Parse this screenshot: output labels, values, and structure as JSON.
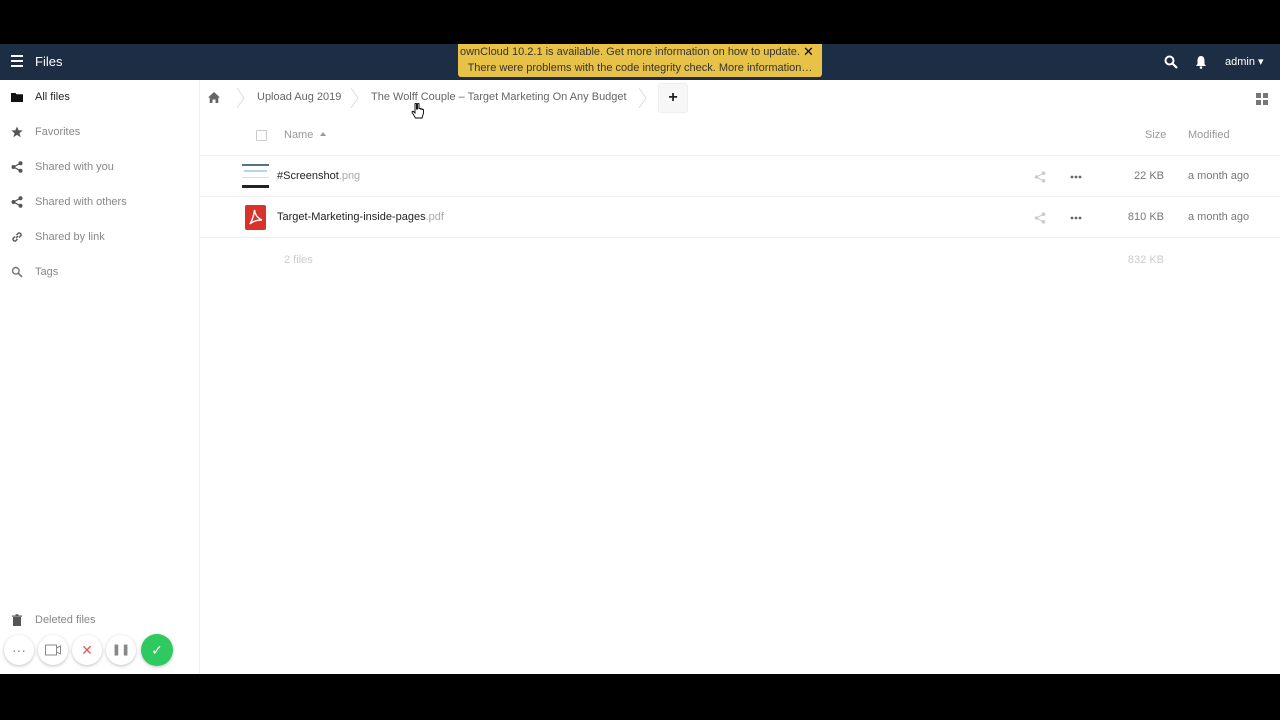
{
  "header": {
    "app_title": "Files",
    "notification_line1": "ownCloud 10.2.1 is available. Get more information on how to update.",
    "notification_line2": "There were problems with the code integrity check. More information…",
    "notification_close": "✕",
    "user": "admin ▾"
  },
  "sidebar": {
    "items": [
      {
        "label": "All files",
        "icon": "folder-icon"
      },
      {
        "label": "Favorites",
        "icon": "star-icon"
      },
      {
        "label": "Shared with you",
        "icon": "share-icon"
      },
      {
        "label": "Shared with others",
        "icon": "share-icon"
      },
      {
        "label": "Shared by link",
        "icon": "link-icon"
      },
      {
        "label": "Tags",
        "icon": "search-icon"
      }
    ],
    "bottom": {
      "deleted_label": "Deleted files"
    }
  },
  "breadcrumb": {
    "items": [
      "Upload Aug 2019",
      "The Wolff Couple – Target Marketing On Any Budget"
    ],
    "new_button": "+"
  },
  "table": {
    "headers": {
      "name": "Name",
      "size": "Size",
      "modified": "Modified"
    },
    "rows": [
      {
        "name": "#Screenshot",
        "ext": ".png",
        "size": "22 KB",
        "modified": "a month ago",
        "type": "image"
      },
      {
        "name": "Target-Marketing-inside-pages",
        "ext": ".pdf",
        "size": "810 KB",
        "modified": "a month ago",
        "type": "pdf"
      }
    ],
    "summary": {
      "count": "2 files",
      "size": "832 KB"
    }
  },
  "recorder": {
    "more": "···",
    "cancel": "✕",
    "pause": "❚❚",
    "done": "✓"
  },
  "colors": {
    "header_bg": "#1d2d44",
    "notify_bg": "#e8c247",
    "pdf_red": "#d9322b",
    "confirm_green": "#2ec95f"
  }
}
